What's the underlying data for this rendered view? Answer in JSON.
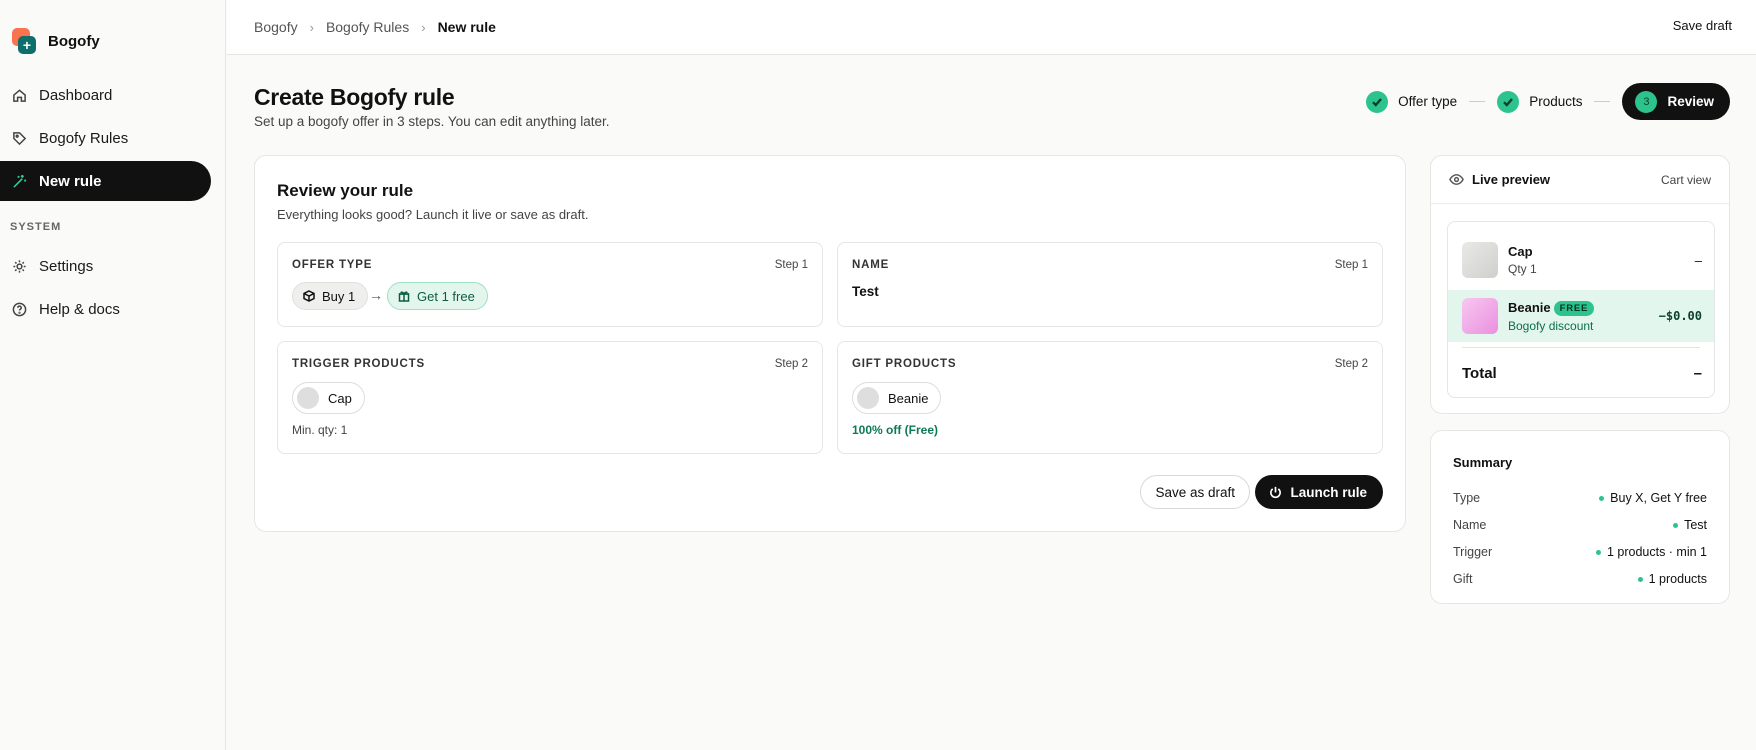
{
  "brand": {
    "name": "Bogofy"
  },
  "sidebar": {
    "items": [
      {
        "label": "Dashboard",
        "icon": "home-icon"
      },
      {
        "label": "Bogofy Rules",
        "icon": "tag-icon"
      },
      {
        "label": "New rule",
        "icon": "magic-wand-icon",
        "active": true
      }
    ],
    "section_label": "SYSTEM",
    "system_items": [
      {
        "label": "Settings",
        "icon": "gear-icon"
      },
      {
        "label": "Help & docs",
        "icon": "help-circle-icon"
      }
    ]
  },
  "topbar": {
    "breadcrumb": [
      "Bogofy",
      "Bogofy Rules",
      "New rule"
    ],
    "save_draft": "Save draft"
  },
  "header": {
    "title": "Create Bogofy rule",
    "subtitle": "Set up a bogofy offer in 3 steps. You can edit anything later."
  },
  "stepper": {
    "steps": [
      {
        "label": "Offer type",
        "state": "done"
      },
      {
        "label": "Products",
        "state": "done"
      },
      {
        "label": "Review",
        "number": "3",
        "state": "current"
      }
    ]
  },
  "review": {
    "title": "Review your rule",
    "subtitle": "Everything looks good? Launch it live or save as draft.",
    "offer_type": {
      "label": "OFFER TYPE",
      "step": "Step 1",
      "buy": "Buy 1",
      "get": "Get 1 free"
    },
    "name": {
      "label": "NAME",
      "step": "Step 1",
      "value": "Test"
    },
    "trigger": {
      "label": "TRIGGER PRODUCTS",
      "step": "Step 2",
      "product": "Cap",
      "meta": "Min. qty: 1"
    },
    "gift": {
      "label": "GIFT PRODUCTS",
      "step": "Step 2",
      "product": "Beanie",
      "meta": "100% off (Free)"
    },
    "save_as_draft": "Save as draft",
    "launch": "Launch rule"
  },
  "preview": {
    "title": "Live preview",
    "view": "Cart view",
    "items": [
      {
        "name": "Cap",
        "sub": "Qty 1",
        "price": "–"
      },
      {
        "name": "Beanie",
        "badge": "FREE",
        "sub": "Bogofy discount",
        "price": "−$0.00"
      }
    ],
    "total_label": "Total",
    "total_value": "–"
  },
  "summary": {
    "title": "Summary",
    "rows": [
      {
        "key": "Type",
        "value": "Buy X, Get Y free"
      },
      {
        "key": "Name",
        "value": "Test"
      },
      {
        "key": "Trigger",
        "value": "1 products · min 1"
      },
      {
        "key": "Gift",
        "value": "1 products"
      }
    ]
  },
  "colors": {
    "accent": "#2dc38d",
    "dark": "#111111",
    "free_bg": "#e3f6ee"
  }
}
